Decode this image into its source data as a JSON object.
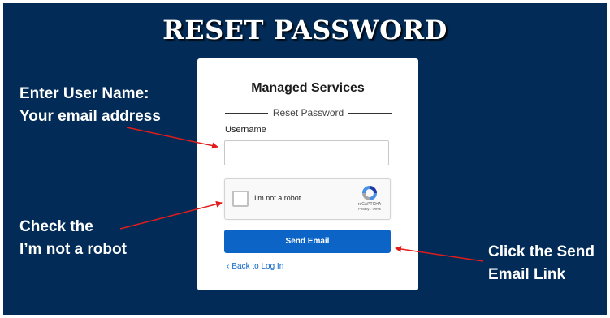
{
  "slide": {
    "title": "RESET PASSWORD"
  },
  "callouts": {
    "username": {
      "line1": "Enter User Name:",
      "line2": "Your email address"
    },
    "robot": {
      "line1": "Check the",
      "line2": "I’m not a robot"
    },
    "send": {
      "line1": "Click the Send",
      "line2": "Email Link"
    }
  },
  "colors": {
    "panel": "#022c57",
    "button": "#0b64c6",
    "arrow": "#e01c1c"
  },
  "card": {
    "title": "Managed Services",
    "section_label": "Reset Password",
    "username_label": "Username",
    "username_value": "",
    "captcha": {
      "label": "I'm not a robot",
      "brand": "reCAPTCHA",
      "links": "Privacy - Terms",
      "icon": "recaptcha-logo-icon"
    },
    "send_button": "Send Email",
    "back_link": "Back to Log In",
    "back_icon": "chevron-left-icon"
  }
}
